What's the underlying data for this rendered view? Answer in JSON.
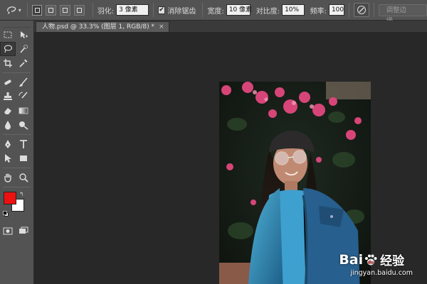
{
  "options_bar": {
    "feather_label": "羽化:",
    "feather_value": "3 像素",
    "antialias_label": "消除锯齿",
    "width_label": "宽度:",
    "width_value": "10 像素",
    "contrast_label": "对比度:",
    "contrast_value": "10%",
    "frequency_label": "频率:",
    "frequency_value": "100",
    "refine_edge_label": "调整边缘..."
  },
  "document": {
    "tab_title": "人物.psd @ 33.3% (图层 1, RGB/8) *",
    "close_glyph": "×"
  },
  "colors": {
    "foreground": "#ee1111",
    "background": "#ffffff",
    "workspace": "#282828",
    "panel": "#535353"
  },
  "watermark": {
    "brand": "Bai",
    "brand_suffix": "经验",
    "url": "jingyan.baidu.com"
  }
}
